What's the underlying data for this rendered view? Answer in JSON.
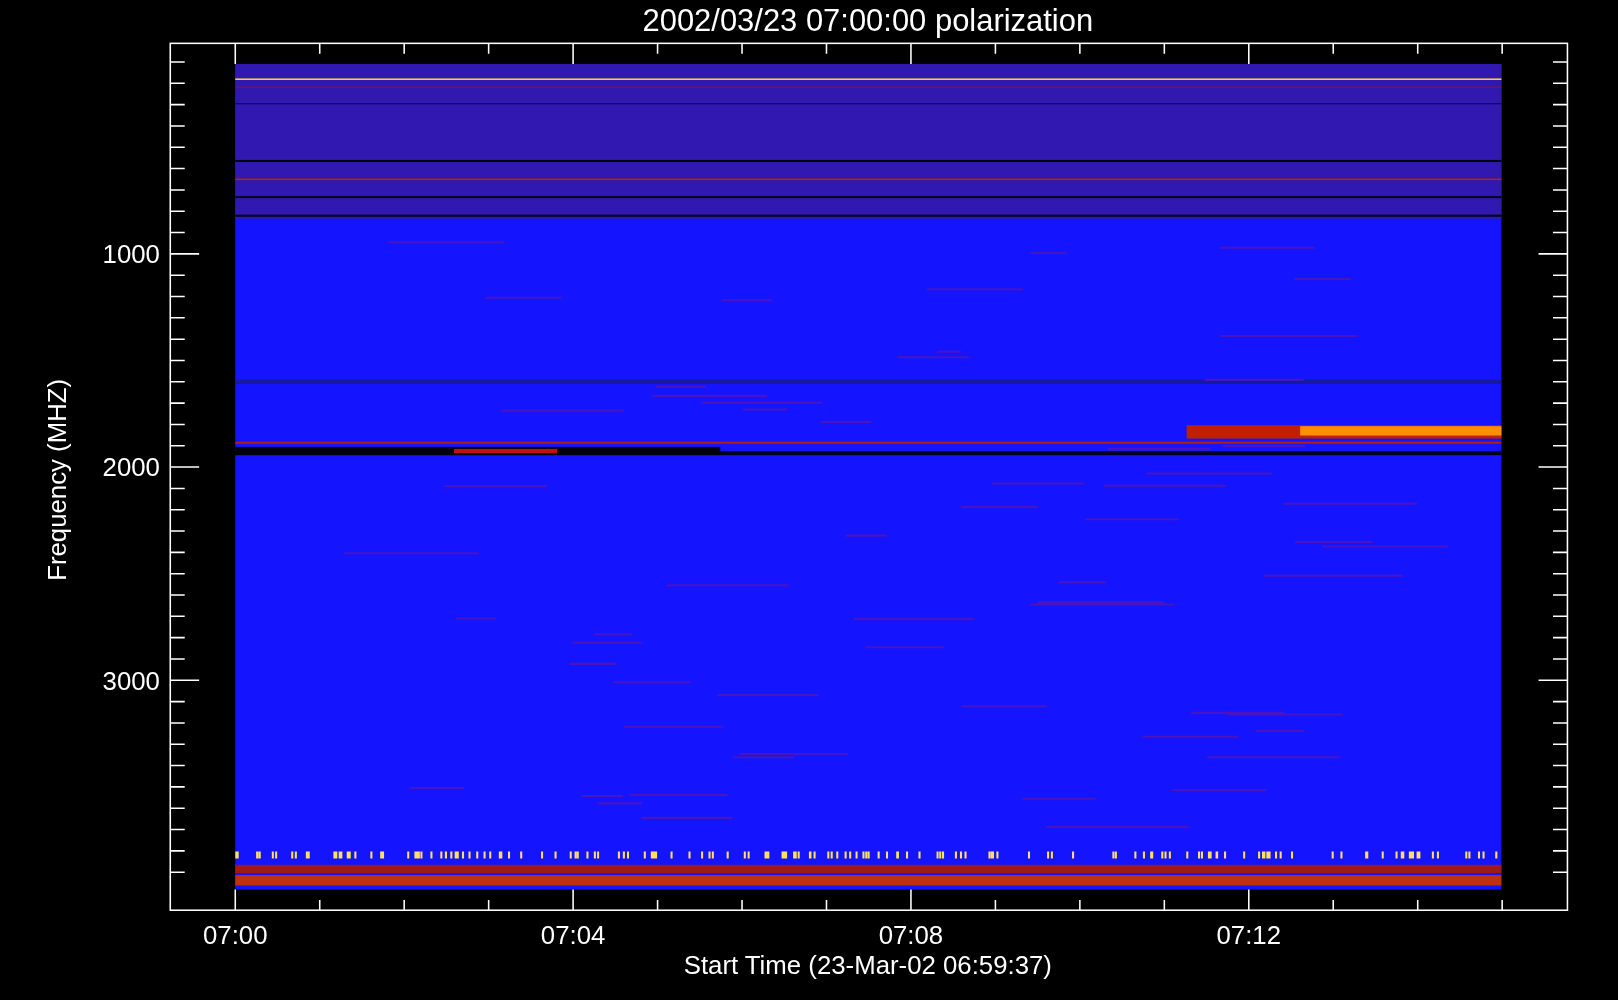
{
  "title": "2002/03/23 07:00:00 polarization",
  "y_axis": {
    "label": "Frequency (MHZ)",
    "ticks": [
      "1000",
      "2000",
      "3000"
    ]
  },
  "x_axis": {
    "label": "Start Time (23-Mar-02 06:59:37)",
    "ticks": [
      "07:00",
      "07:04",
      "07:08",
      "07:12"
    ]
  }
}
